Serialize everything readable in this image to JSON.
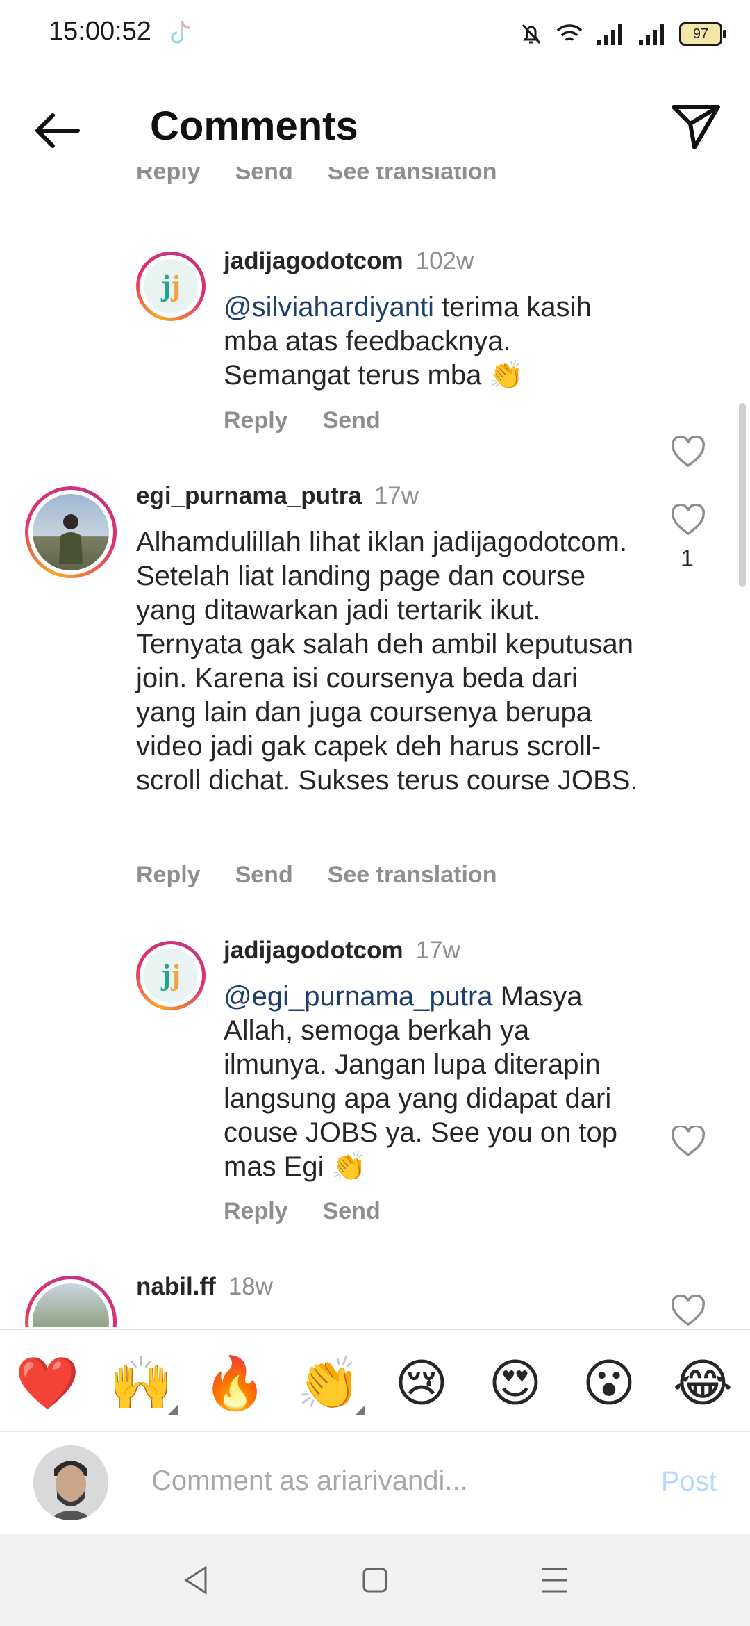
{
  "status": {
    "time": "15:00:52",
    "battery": "97"
  },
  "header": {
    "title": "Comments"
  },
  "top_partial_actions": {
    "reply": "Reply",
    "send": "Send",
    "see_translation": "See translation"
  },
  "comments": [
    {
      "username": "jadijagodotcom",
      "age": "102w",
      "mention": "@silviahardiyanti",
      "text": " terima kasih mba atas feedbacknya. Semangat terus mba 👏",
      "actions": {
        "reply": "Reply",
        "send": "Send"
      }
    },
    {
      "username": "egi_purnama_putra",
      "age": "17w",
      "text": "Alhamdulillah lihat iklan jadijagodotcom. Setelah liat landing page dan course yang ditawarkan jadi tertarik ikut. Ternyata gak salah deh ambil keputusan join. Karena isi coursenya beda dari yang lain dan juga coursenya berupa video jadi gak capek deh harus scroll-scroll dichat. Sukses terus course JOBS.",
      "likes": "1",
      "actions": {
        "reply": "Reply",
        "send": "Send",
        "see_translation": "See translation"
      }
    },
    {
      "username": "jadijagodotcom",
      "age": "17w",
      "mention": "@egi_purnama_putra",
      "text": " Masya Allah, semoga berkah ya ilmunya. Jangan lupa diterapin langsung apa yang didapat dari couse JOBS ya. See you on top mas Egi 👏",
      "actions": {
        "reply": "Reply",
        "send": "Send"
      }
    },
    {
      "username": "nabil.ff",
      "age": "18w"
    }
  ],
  "emoji_bar": [
    "❤️",
    "🙌",
    "🔥",
    "👏",
    "😢",
    "😍",
    "😮",
    "😂"
  ],
  "composer": {
    "placeholder": "Comment as ariarivandi...",
    "post_label": "Post"
  }
}
